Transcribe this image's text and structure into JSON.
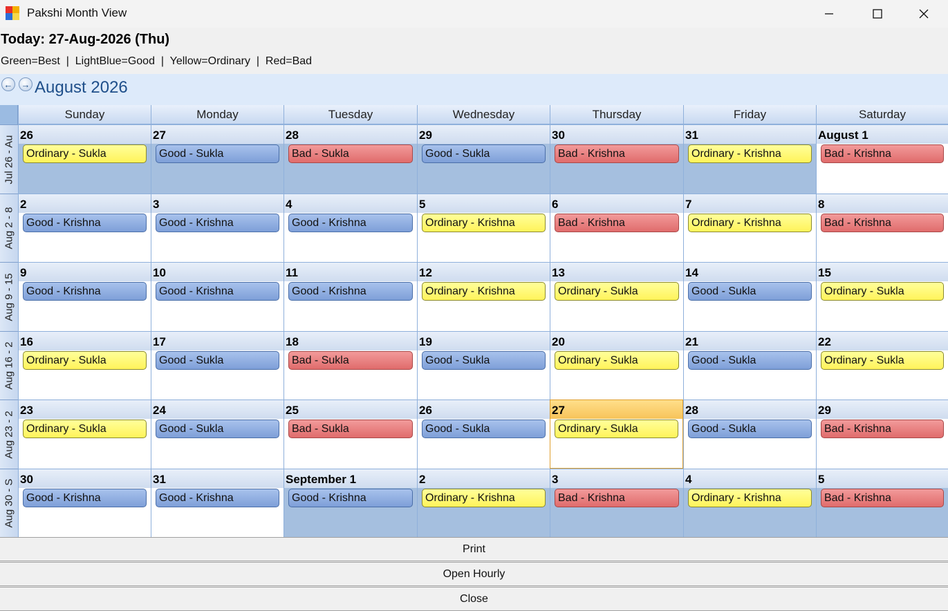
{
  "window": {
    "title": "Pakshi Month View",
    "icon": "app-window-icon",
    "controls": [
      "minimize-icon",
      "maximize-icon",
      "close-icon"
    ]
  },
  "today_label": "Today: 27-Aug-2026 (Thu)",
  "legend": "Green=Best  |  LightBlue=Good  |  Yellow=Ordinary  |  Red=Bad",
  "calendar": {
    "month_title": "August 2026",
    "prev_icon": "arrow-left-icon",
    "next_icon": "arrow-right-icon",
    "days_of_week": [
      "Sunday",
      "Monday",
      "Tuesday",
      "Wednesday",
      "Thursday",
      "Friday",
      "Saturday"
    ],
    "category_colors": {
      "Good": "#8fadde",
      "Ordinary": "#fff86a",
      "Bad": "#ea8080",
      "today_highlight": "#f9cd68",
      "other_month": "#a5bfdf"
    },
    "weeks": [
      {
        "label": "Jul 26 - Au",
        "days": [
          {
            "date": "26",
            "event": "Ordinary - Sukla",
            "type": "ordinary",
            "other_month": true
          },
          {
            "date": "27",
            "event": "Good - Sukla",
            "type": "good",
            "other_month": true
          },
          {
            "date": "28",
            "event": "Bad - Sukla",
            "type": "bad",
            "other_month": true
          },
          {
            "date": "29",
            "event": "Good - Sukla",
            "type": "good",
            "other_month": true
          },
          {
            "date": "30",
            "event": "Bad - Krishna",
            "type": "bad",
            "other_month": true
          },
          {
            "date": "31",
            "event": "Ordinary - Krishna",
            "type": "ordinary",
            "other_month": true
          },
          {
            "date": "August 1",
            "event": "Bad - Krishna",
            "type": "bad",
            "other_month": false
          }
        ]
      },
      {
        "label": "Aug 2 - 8",
        "days": [
          {
            "date": "2",
            "event": "Good - Krishna",
            "type": "good",
            "other_month": false
          },
          {
            "date": "3",
            "event": "Good - Krishna",
            "type": "good",
            "other_month": false
          },
          {
            "date": "4",
            "event": "Good - Krishna",
            "type": "good",
            "other_month": false
          },
          {
            "date": "5",
            "event": "Ordinary - Krishna",
            "type": "ordinary",
            "other_month": false
          },
          {
            "date": "6",
            "event": "Bad - Krishna",
            "type": "bad",
            "other_month": false
          },
          {
            "date": "7",
            "event": "Ordinary - Krishna",
            "type": "ordinary",
            "other_month": false
          },
          {
            "date": "8",
            "event": "Bad - Krishna",
            "type": "bad",
            "other_month": false
          }
        ]
      },
      {
        "label": "Aug 9 - 15",
        "days": [
          {
            "date": "9",
            "event": "Good - Krishna",
            "type": "good",
            "other_month": false
          },
          {
            "date": "10",
            "event": "Good - Krishna",
            "type": "good",
            "other_month": false
          },
          {
            "date": "11",
            "event": "Good - Krishna",
            "type": "good",
            "other_month": false
          },
          {
            "date": "12",
            "event": "Ordinary - Krishna",
            "type": "ordinary",
            "other_month": false
          },
          {
            "date": "13",
            "event": "Ordinary - Sukla",
            "type": "ordinary",
            "other_month": false
          },
          {
            "date": "14",
            "event": "Good - Sukla",
            "type": "good",
            "other_month": false
          },
          {
            "date": "15",
            "event": "Ordinary - Sukla",
            "type": "ordinary",
            "other_month": false
          }
        ]
      },
      {
        "label": "Aug 16 - 2",
        "days": [
          {
            "date": "16",
            "event": "Ordinary - Sukla",
            "type": "ordinary",
            "other_month": false
          },
          {
            "date": "17",
            "event": "Good - Sukla",
            "type": "good",
            "other_month": false
          },
          {
            "date": "18",
            "event": "Bad - Sukla",
            "type": "bad",
            "other_month": false
          },
          {
            "date": "19",
            "event": "Good - Sukla",
            "type": "good",
            "other_month": false
          },
          {
            "date": "20",
            "event": "Ordinary - Sukla",
            "type": "ordinary",
            "other_month": false
          },
          {
            "date": "21",
            "event": "Good - Sukla",
            "type": "good",
            "other_month": false
          },
          {
            "date": "22",
            "event": "Ordinary - Sukla",
            "type": "ordinary",
            "other_month": false
          }
        ]
      },
      {
        "label": "Aug 23 - 2",
        "days": [
          {
            "date": "23",
            "event": "Ordinary - Sukla",
            "type": "ordinary",
            "other_month": false
          },
          {
            "date": "24",
            "event": "Good - Sukla",
            "type": "good",
            "other_month": false
          },
          {
            "date": "25",
            "event": "Bad - Sukla",
            "type": "bad",
            "other_month": false
          },
          {
            "date": "26",
            "event": "Good - Sukla",
            "type": "good",
            "other_month": false
          },
          {
            "date": "27",
            "event": "Ordinary - Sukla",
            "type": "ordinary",
            "other_month": false,
            "today": true
          },
          {
            "date": "28",
            "event": "Good - Sukla",
            "type": "good",
            "other_month": false
          },
          {
            "date": "29",
            "event": "Bad - Krishna",
            "type": "bad",
            "other_month": false
          }
        ]
      },
      {
        "label": "Aug 30 - S",
        "days": [
          {
            "date": "30",
            "event": "Good - Krishna",
            "type": "good",
            "other_month": false
          },
          {
            "date": "31",
            "event": "Good - Krishna",
            "type": "good",
            "other_month": false
          },
          {
            "date": "September 1",
            "event": "Good - Krishna",
            "type": "good",
            "other_month": true
          },
          {
            "date": "2",
            "event": "Ordinary - Krishna",
            "type": "ordinary",
            "other_month": true
          },
          {
            "date": "3",
            "event": "Bad - Krishna",
            "type": "bad",
            "other_month": true
          },
          {
            "date": "4",
            "event": "Ordinary - Krishna",
            "type": "ordinary",
            "other_month": true
          },
          {
            "date": "5",
            "event": "Bad - Krishna",
            "type": "bad",
            "other_month": true
          }
        ]
      }
    ]
  },
  "buttons": {
    "print": "Print",
    "open_hourly": "Open Hourly",
    "close": "Close"
  }
}
